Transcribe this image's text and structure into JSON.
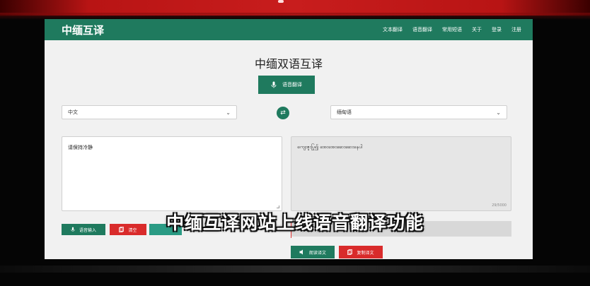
{
  "navbar": {
    "logo": "中缅互译",
    "links": [
      "文本翻译",
      "语音翻译",
      "常用短语",
      "关于",
      "登录",
      "注册"
    ]
  },
  "main": {
    "title": "中缅双语互译",
    "voice_button_label": "语音翻译",
    "source_lang": "中文",
    "target_lang": "缅甸语",
    "source_text": "请保持冷静",
    "output_text": "ကျေးဇူးပြု၍ အေးအေးဆေးဆေးနေပါ",
    "char_count": "29/5000",
    "voice_input_label": "语音输入",
    "clear_label": "清空",
    "read_label": "朗读译文",
    "copy_label": "复制译文"
  },
  "subtitle": "中缅互译网站上线语音翻译功能",
  "colors": {
    "brand": "#1f7a5e",
    "danger": "#d92b2b",
    "teal": "#2a9b84"
  },
  "icons": [
    "mic-icon",
    "swap-icon",
    "copy-icon",
    "speaker-icon",
    "chevron-down-icon"
  ]
}
